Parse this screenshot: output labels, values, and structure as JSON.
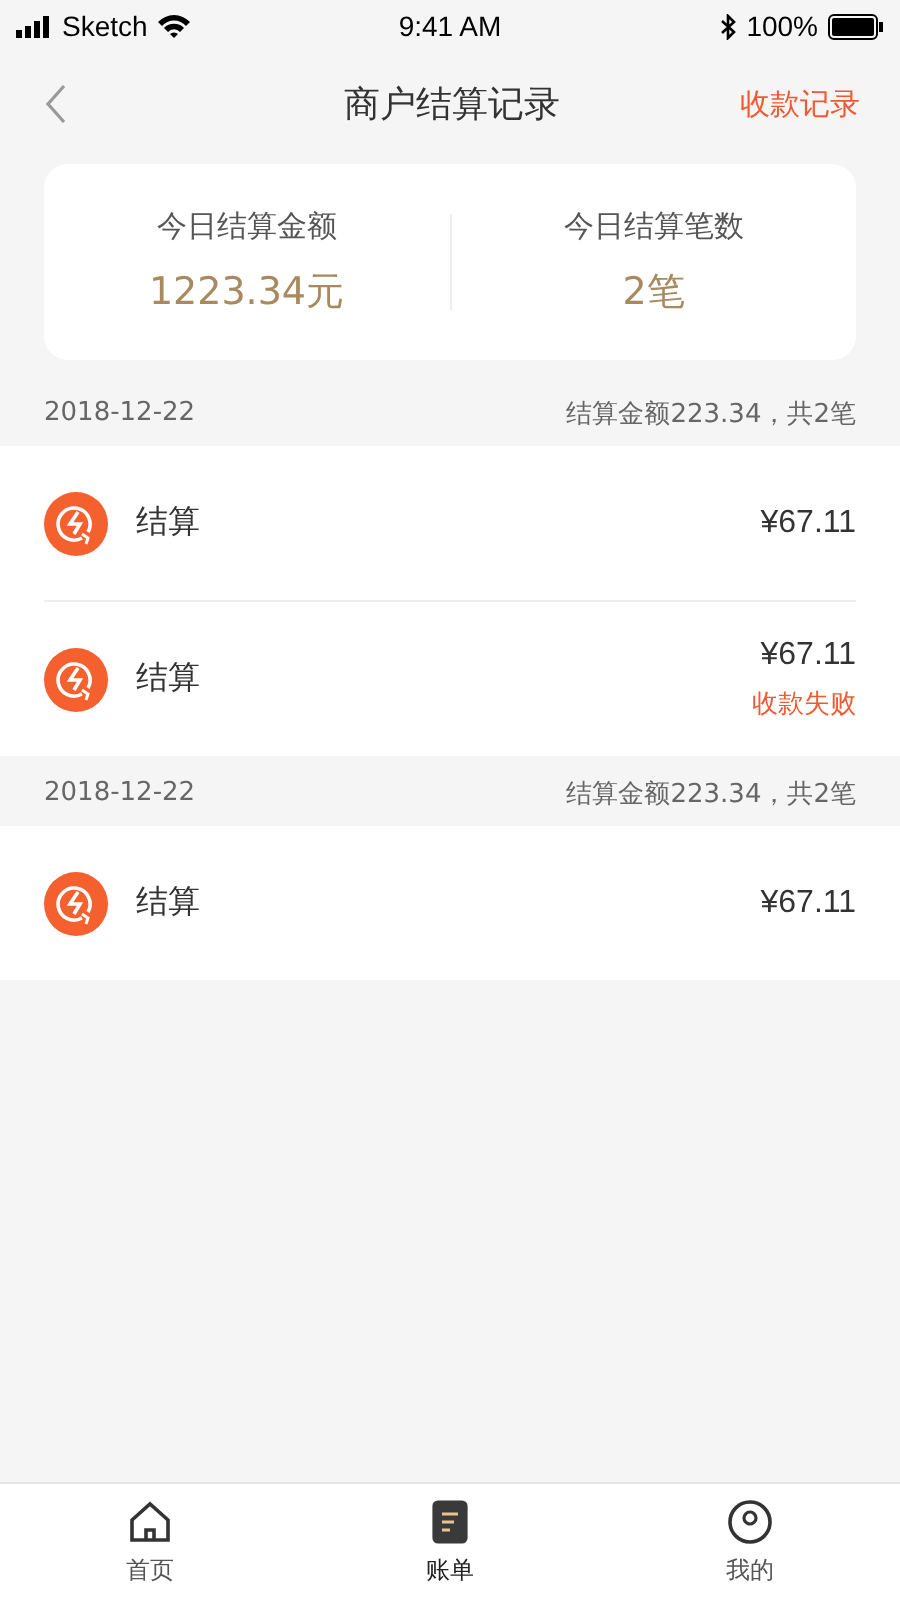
{
  "status_bar": {
    "carrier": "Sketch",
    "time": "9:41 AM",
    "battery": "100%"
  },
  "nav": {
    "title": "商户结算记录",
    "action": "收款记录"
  },
  "summary": [
    {
      "label": "今日结算金额",
      "value": "1223.34元"
    },
    {
      "label": "今日结算笔数",
      "value": "2笔"
    }
  ],
  "groups": [
    {
      "date": "2018-12-22",
      "total": "结算金额223.34，共2笔",
      "records": [
        {
          "title": "结算",
          "amount": "¥67.11"
        },
        {
          "title": "结算",
          "amount": "¥67.11",
          "status": "收款失败"
        }
      ]
    },
    {
      "date": "2018-12-22",
      "total": "结算金额223.34，共2笔",
      "records": [
        {
          "title": "结算",
          "amount": "¥67.11"
        }
      ]
    }
  ],
  "tabs": [
    {
      "label": "首页",
      "kind": "home",
      "selected": false
    },
    {
      "label": "账单",
      "kind": "bill",
      "selected": true
    },
    {
      "label": "我的",
      "kind": "me",
      "selected": false
    }
  ]
}
